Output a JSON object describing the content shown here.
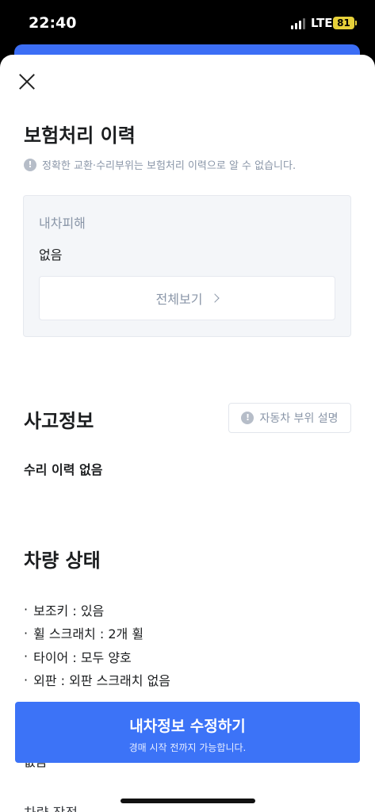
{
  "status_bar": {
    "time": "22:40",
    "network": "LTE",
    "battery": "81"
  },
  "insurance": {
    "title": "보험처리 이력",
    "notice": "정확한 교환·수리부위는 보험처리 이력으로 알 수 없습니다.",
    "damage_label": "내차피해",
    "damage_value": "없음",
    "view_all": "전체보기"
  },
  "accident": {
    "title": "사고정보",
    "parts_button": "자동차 부위 설명",
    "repair_history": "수리 이력 없음"
  },
  "condition": {
    "title": "차량 상태",
    "items": [
      "보조키 : 있음",
      "휠 스크래치 : 2개 휠",
      "타이어 : 모두 양호",
      "외판 : 외판 스크래치 없음"
    ],
    "partial_below": "없음",
    "next_section_partial": "차량 장점"
  },
  "cta": {
    "label": "내차정보 수정하기",
    "sub": "경매 시작 전까지 가능합니다."
  }
}
